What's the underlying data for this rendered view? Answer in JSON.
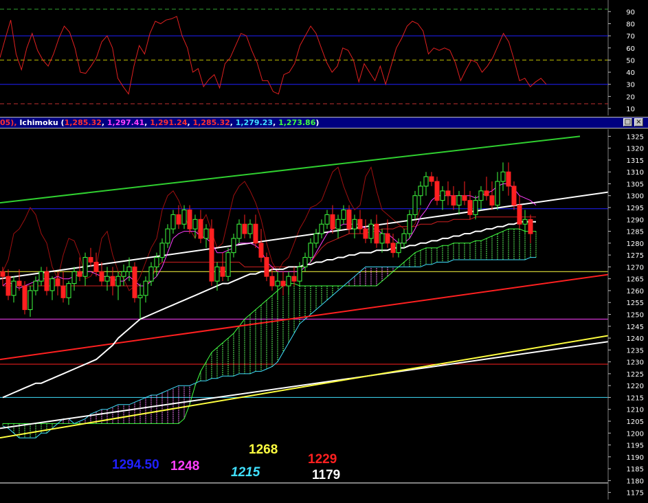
{
  "rsi": {
    "yticks": [
      "90",
      "80",
      "70",
      "60",
      "50",
      "40",
      "30",
      "20",
      "10"
    ],
    "series": [
      52,
      68,
      83,
      55,
      42,
      60,
      72,
      58,
      50,
      45,
      55,
      68,
      78,
      73,
      60,
      40,
      39,
      45,
      52,
      65,
      70,
      60,
      35,
      28,
      22,
      45,
      62,
      55,
      72,
      82,
      80,
      83,
      84,
      86,
      70,
      60,
      40,
      43,
      28,
      34,
      38,
      27,
      47,
      52,
      62,
      72,
      70,
      58,
      48,
      33,
      33,
      24,
      22,
      38,
      40,
      47,
      62,
      70,
      78,
      72,
      60,
      48,
      40,
      45,
      60,
      58,
      50,
      32,
      47,
      40,
      33,
      45,
      30,
      45,
      60,
      68,
      78,
      82,
      80,
      74,
      55,
      60,
      58,
      60,
      58,
      48,
      33,
      42,
      50,
      48,
      40,
      45,
      52,
      62,
      72,
      65,
      50,
      33,
      35,
      28,
      32,
      35,
      30
    ]
  },
  "titlebar": {
    "prefix": "05), ",
    "name": "Ichimoku (",
    "v1": "1,285.32",
    "v2": "1,297.41",
    "v3": "1,291.24",
    "v4": "1,285.32",
    "v5": "1,279.23",
    "v6": "1,273.86",
    "suffix": ")",
    "c1": "#ff3030",
    "c2": "#ff40ff",
    "c3": "#ff3030",
    "c4": "#ff3030",
    "c5": "#40e0ff",
    "c6": "#40ff40",
    "max_btn": "□",
    "close_btn": "×"
  },
  "levels": {
    "l1294": {
      "text": "1294.50",
      "color": "#2020ff"
    },
    "l1248": {
      "text": "1248",
      "color": "#ff40ff"
    },
    "l1268": {
      "text": "1268",
      "color": "#ffff40"
    },
    "l1215": {
      "text": "1215",
      "color": "#40e0ff"
    },
    "l1229": {
      "text": "1229",
      "color": "#ff2020"
    },
    "l1179": {
      "text": "1179",
      "color": "#ffffff"
    }
  },
  "chart_data": {
    "type": "candlestick",
    "ylim": [
      1172,
      1328
    ],
    "yticks": [
      1325,
      1320,
      1315,
      1310,
      1305,
      1300,
      1295,
      1290,
      1285,
      1280,
      1275,
      1270,
      1265,
      1260,
      1255,
      1250,
      1245,
      1240,
      1235,
      1230,
      1225,
      1220,
      1215,
      1210,
      1205,
      1200,
      1195,
      1190,
      1185,
      1180,
      1175
    ],
    "horizontal_lines": [
      {
        "value": 1294.5,
        "color": "#2020ff"
      },
      {
        "value": 1268,
        "color": "#ffff40"
      },
      {
        "value": 1248,
        "color": "#ff40ff"
      },
      {
        "value": 1229,
        "color": "#ff2020"
      },
      {
        "value": 1215,
        "color": "#40e0ff"
      },
      {
        "value": 1179,
        "color": "#ffffff"
      }
    ],
    "trendlines": [
      {
        "from": [
          0,
          1297
        ],
        "to": [
          105,
          1325
        ],
        "color": "#30d030"
      },
      {
        "from": [
          0,
          1265
        ],
        "to": [
          148,
          1314
        ],
        "color": "#ffffff"
      },
      {
        "from": [
          0,
          1231
        ],
        "to": [
          148,
          1279
        ],
        "color": "#ff2020"
      },
      {
        "from": [
          0,
          1202
        ],
        "to": [
          148,
          1251
        ],
        "color": "#ffffff"
      },
      {
        "from": [
          0,
          1198
        ],
        "to": [
          128,
          1248
        ],
        "color": "#ffff40"
      }
    ],
    "candles": [
      [
        1268,
        1270,
        1262,
        1266
      ],
      [
        1266,
        1269,
        1256,
        1258
      ],
      [
        1258,
        1266,
        1255,
        1264
      ],
      [
        1264,
        1269,
        1260,
        1262
      ],
      [
        1262,
        1264,
        1250,
        1252
      ],
      [
        1252,
        1262,
        1249,
        1260
      ],
      [
        1260,
        1266,
        1258,
        1264
      ],
      [
        1264,
        1270,
        1262,
        1268
      ],
      [
        1268,
        1270,
        1258,
        1260
      ],
      [
        1260,
        1266,
        1256,
        1265
      ],
      [
        1265,
        1268,
        1258,
        1262
      ],
      [
        1262,
        1268,
        1255,
        1257
      ],
      [
        1257,
        1264,
        1254,
        1263
      ],
      [
        1263,
        1270,
        1260,
        1268
      ],
      [
        1268,
        1274,
        1264,
        1266
      ],
      [
        1266,
        1276,
        1262,
        1274
      ],
      [
        1274,
        1278,
        1270,
        1272
      ],
      [
        1272,
        1276,
        1266,
        1268
      ],
      [
        1268,
        1272,
        1262,
        1264
      ],
      [
        1264,
        1270,
        1260,
        1266
      ],
      [
        1266,
        1270,
        1258,
        1262
      ],
      [
        1262,
        1268,
        1256,
        1266
      ],
      [
        1266,
        1271,
        1262,
        1268
      ],
      [
        1268,
        1274,
        1264,
        1270
      ],
      [
        1270,
        1272,
        1255,
        1257
      ],
      [
        1257,
        1263,
        1248,
        1258
      ],
      [
        1258,
        1266,
        1255,
        1264
      ],
      [
        1264,
        1272,
        1262,
        1270
      ],
      [
        1270,
        1276,
        1266,
        1274
      ],
      [
        1274,
        1282,
        1272,
        1280
      ],
      [
        1280,
        1288,
        1278,
        1286
      ],
      [
        1286,
        1294,
        1284,
        1292
      ],
      [
        1292,
        1296,
        1286,
        1288
      ],
      [
        1288,
        1296,
        1286,
        1294
      ],
      [
        1294,
        1296,
        1284,
        1286
      ],
      [
        1286,
        1292,
        1282,
        1290
      ],
      [
        1290,
        1294,
        1280,
        1282
      ],
      [
        1282,
        1288,
        1278,
        1286
      ],
      [
        1286,
        1290,
        1262,
        1264
      ],
      [
        1264,
        1272,
        1260,
        1270
      ],
      [
        1270,
        1276,
        1264,
        1266
      ],
      [
        1266,
        1278,
        1264,
        1276
      ],
      [
        1276,
        1284,
        1274,
        1282
      ],
      [
        1282,
        1290,
        1280,
        1288
      ],
      [
        1288,
        1292,
        1282,
        1284
      ],
      [
        1284,
        1290,
        1282,
        1288
      ],
      [
        1288,
        1292,
        1278,
        1280
      ],
      [
        1280,
        1286,
        1272,
        1274
      ],
      [
        1274,
        1276,
        1264,
        1266
      ],
      [
        1266,
        1270,
        1260,
        1262
      ],
      [
        1262,
        1268,
        1256,
        1264
      ],
      [
        1264,
        1268,
        1258,
        1262
      ],
      [
        1262,
        1268,
        1258,
        1266
      ],
      [
        1266,
        1270,
        1262,
        1264
      ],
      [
        1264,
        1272,
        1262,
        1270
      ],
      [
        1270,
        1276,
        1268,
        1274
      ],
      [
        1274,
        1282,
        1272,
        1280
      ],
      [
        1280,
        1286,
        1278,
        1284
      ],
      [
        1284,
        1290,
        1282,
        1288
      ],
      [
        1288,
        1294,
        1286,
        1292
      ],
      [
        1292,
        1296,
        1284,
        1286
      ],
      [
        1286,
        1292,
        1282,
        1290
      ],
      [
        1290,
        1296,
        1288,
        1294
      ],
      [
        1294,
        1296,
        1284,
        1286
      ],
      [
        1286,
        1292,
        1282,
        1290
      ],
      [
        1290,
        1294,
        1284,
        1286
      ],
      [
        1286,
        1290,
        1280,
        1282
      ],
      [
        1282,
        1290,
        1280,
        1288
      ],
      [
        1288,
        1292,
        1278,
        1280
      ],
      [
        1280,
        1286,
        1276,
        1284
      ],
      [
        1284,
        1290,
        1278,
        1280
      ],
      [
        1280,
        1284,
        1274,
        1276
      ],
      [
        1276,
        1282,
        1274,
        1280
      ],
      [
        1280,
        1286,
        1278,
        1284
      ],
      [
        1284,
        1294,
        1282,
        1292
      ],
      [
        1292,
        1302,
        1290,
        1300
      ],
      [
        1300,
        1306,
        1296,
        1304
      ],
      [
        1304,
        1310,
        1300,
        1308
      ],
      [
        1308,
        1310,
        1304,
        1306
      ],
      [
        1306,
        1308,
        1296,
        1298
      ],
      [
        1298,
        1304,
        1294,
        1302
      ],
      [
        1302,
        1306,
        1296,
        1300
      ],
      [
        1300,
        1304,
        1294,
        1296
      ],
      [
        1296,
        1302,
        1292,
        1300
      ],
      [
        1300,
        1306,
        1296,
        1298
      ],
      [
        1298,
        1302,
        1290,
        1292
      ],
      [
        1292,
        1300,
        1290,
        1298
      ],
      [
        1298,
        1304,
        1294,
        1302
      ],
      [
        1302,
        1308,
        1298,
        1300
      ],
      [
        1300,
        1306,
        1294,
        1296
      ],
      [
        1296,
        1310,
        1294,
        1306
      ],
      [
        1306,
        1314,
        1302,
        1310
      ],
      [
        1310,
        1314,
        1300,
        1304
      ],
      [
        1304,
        1306,
        1294,
        1296
      ],
      [
        1296,
        1300,
        1286,
        1288
      ],
      [
        1288,
        1294,
        1284,
        1290
      ],
      [
        1290,
        1292,
        1280,
        1284
      ]
    ],
    "kijun": [
      1262,
      1262,
      1262,
      1262,
      1262,
      1262,
      1262,
      1262,
      1262,
      1262,
      1262,
      1262,
      1262,
      1262,
      1262,
      1262,
      1262,
      1262,
      1262,
      1262,
      1262,
      1262,
      1262,
      1262,
      1262,
      1262,
      1262,
      1265,
      1270,
      1272,
      1272,
      1272,
      1272,
      1272,
      1272,
      1272,
      1272,
      1272,
      1272,
      1272,
      1272,
      1272,
      1272,
      1272,
      1270,
      1270,
      1270,
      1270,
      1270,
      1270,
      1270,
      1270,
      1270,
      1270,
      1270,
      1270,
      1272,
      1275,
      1278,
      1280,
      1281,
      1282,
      1283,
      1284,
      1284,
      1284,
      1284,
      1285,
      1285,
      1286,
      1286,
      1286,
      1287,
      1287,
      1287,
      1287,
      1288,
      1288,
      1288,
      1289,
      1289,
      1289,
      1290,
      1290,
      1290,
      1290,
      1291,
      1291,
      1291,
      1291,
      1291,
      1291,
      1291,
      1291,
      1291,
      1291,
      1291,
      1291
    ],
    "tenkan": [
      1262,
      1264,
      1262,
      1261,
      1262,
      1263,
      1264,
      1265,
      1265,
      1265,
      1266,
      1265,
      1265,
      1266,
      1267,
      1268,
      1268,
      1267,
      1266,
      1266,
      1265,
      1264,
      1264,
      1266,
      1264,
      1262,
      1262,
      1264,
      1266,
      1270,
      1276,
      1282,
      1284,
      1285,
      1285,
      1285,
      1283,
      1282,
      1280,
      1276,
      1276,
      1277,
      1278,
      1280,
      1280,
      1280,
      1279,
      1277,
      1272,
      1270,
      1268,
      1268,
      1268,
      1268,
      1268,
      1270,
      1272,
      1276,
      1280,
      1284,
      1286,
      1287,
      1288,
      1288,
      1288,
      1288,
      1286,
      1286,
      1286,
      1284,
      1284,
      1282,
      1280,
      1280,
      1282,
      1286,
      1291,
      1294,
      1298,
      1300,
      1300,
      1300,
      1300,
      1300,
      1300,
      1300,
      1299,
      1300,
      1301,
      1302,
      1304,
      1305,
      1305,
      1303,
      1300,
      1299,
      1298,
      1296
    ],
    "chikou": [
      1268,
      1273,
      1284,
      1286,
      1290,
      1295,
      1292,
      1284,
      1280,
      1270,
      1265,
      1275,
      1282,
      1281,
      1275,
      1265,
      1266,
      1270,
      1282,
      1285,
      1275,
      1268,
      1265,
      1260,
      1262,
      1266,
      1272,
      1278,
      1282,
      1294,
      1300,
      1302,
      1298,
      1292,
      1286,
      1282,
      1288,
      1292,
      1285,
      1278,
      1280,
      1290,
      1300,
      1304,
      1306,
      1302,
      1297,
      1290,
      1280,
      1272,
      1268,
      1272,
      1274,
      1280,
      1286,
      1290,
      1295,
      1296,
      1298,
      1304,
      1310,
      1312,
      1304,
      1298,
      1294,
      1296,
      1308,
      1312,
      1302,
      1294,
      1292,
      1290,
      1288,
      1286,
      1286,
      1288,
      1295
    ],
    "ma": [
      1215,
      1216,
      1217,
      1218,
      1219,
      1220,
      1221,
      1221,
      1222,
      1223,
      1224,
      1225,
      1226,
      1227,
      1228,
      1229,
      1230,
      1231,
      1233,
      1235,
      1237,
      1240,
      1242,
      1244,
      1246,
      1248,
      1249,
      1250,
      1251,
      1252,
      1253,
      1254,
      1255,
      1256,
      1257,
      1258,
      1259,
      1260,
      1261,
      1262,
      1263,
      1263,
      1264,
      1265,
      1266,
      1267,
      1267,
      1268,
      1268,
      1269,
      1269,
      1269,
      1270,
      1270,
      1270,
      1271,
      1271,
      1272,
      1272,
      1273,
      1273,
      1274,
      1274,
      1275,
      1275,
      1276,
      1276,
      1276,
      1277,
      1277,
      1277,
      1278,
      1278,
      1278,
      1279,
      1279,
      1280,
      1280,
      1281,
      1281,
      1282,
      1282,
      1283,
      1283,
      1284,
      1284,
      1285,
      1285,
      1286,
      1286,
      1287,
      1287,
      1288,
      1288,
      1289,
      1289,
      1289,
      1289
    ],
    "spanA": [
      1204,
      1204,
      1204,
      1204,
      1204,
      1204,
      1204,
      1204,
      1204,
      1204,
      1204,
      1204,
      1204,
      1204,
      1204,
      1204,
      1204,
      1204,
      1204,
      1204,
      1204,
      1204,
      1204,
      1204,
      1204,
      1204,
      1204,
      1204,
      1204,
      1204,
      1204,
      1204,
      1204,
      1206,
      1212,
      1220,
      1226,
      1230,
      1234,
      1236,
      1238,
      1240,
      1242,
      1245,
      1248,
      1250,
      1252,
      1254,
      1256,
      1258,
      1260,
      1262,
      1263,
      1263,
      1262,
      1262,
      1262,
      1262,
      1262,
      1262,
      1262,
      1262,
      1262,
      1262,
      1262,
      1262,
      1262,
      1262,
      1262,
      1264,
      1266,
      1268,
      1270,
      1272,
      1274,
      1276,
      1277,
      1278,
      1278,
      1278,
      1279,
      1279,
      1280,
      1280,
      1280,
      1280,
      1281,
      1281,
      1282,
      1283,
      1284,
      1285,
      1286,
      1286,
      1286,
      1285,
      1285,
      1285
    ],
    "spanB": [
      1203,
      1202,
      1200,
      1198,
      1198,
      1198,
      1198,
      1200,
      1200,
      1202,
      1204,
      1206,
      1206,
      1204,
      1205,
      1206,
      1208,
      1209,
      1210,
      1210,
      1211,
      1212,
      1212,
      1212,
      1213,
      1214,
      1215,
      1216,
      1216,
      1217,
      1218,
      1219,
      1220,
      1220,
      1220,
      1221,
      1222,
      1222,
      1223,
      1223,
      1224,
      1224,
      1224,
      1225,
      1225,
      1225,
      1226,
      1226,
      1227,
      1228,
      1230,
      1234,
      1238,
      1242,
      1246,
      1248,
      1250,
      1252,
      1254,
      1256,
      1258,
      1260,
      1262,
      1264,
      1266,
      1268,
      1270,
      1270,
      1270,
      1270,
      1270,
      1270,
      1270,
      1270,
      1270,
      1270,
      1270,
      1271,
      1271,
      1272,
      1272,
      1272,
      1273,
      1273,
      1273,
      1273,
      1273,
      1273,
      1273,
      1273,
      1273,
      1273,
      1273,
      1273,
      1273,
      1273,
      1274,
      1274
    ]
  }
}
